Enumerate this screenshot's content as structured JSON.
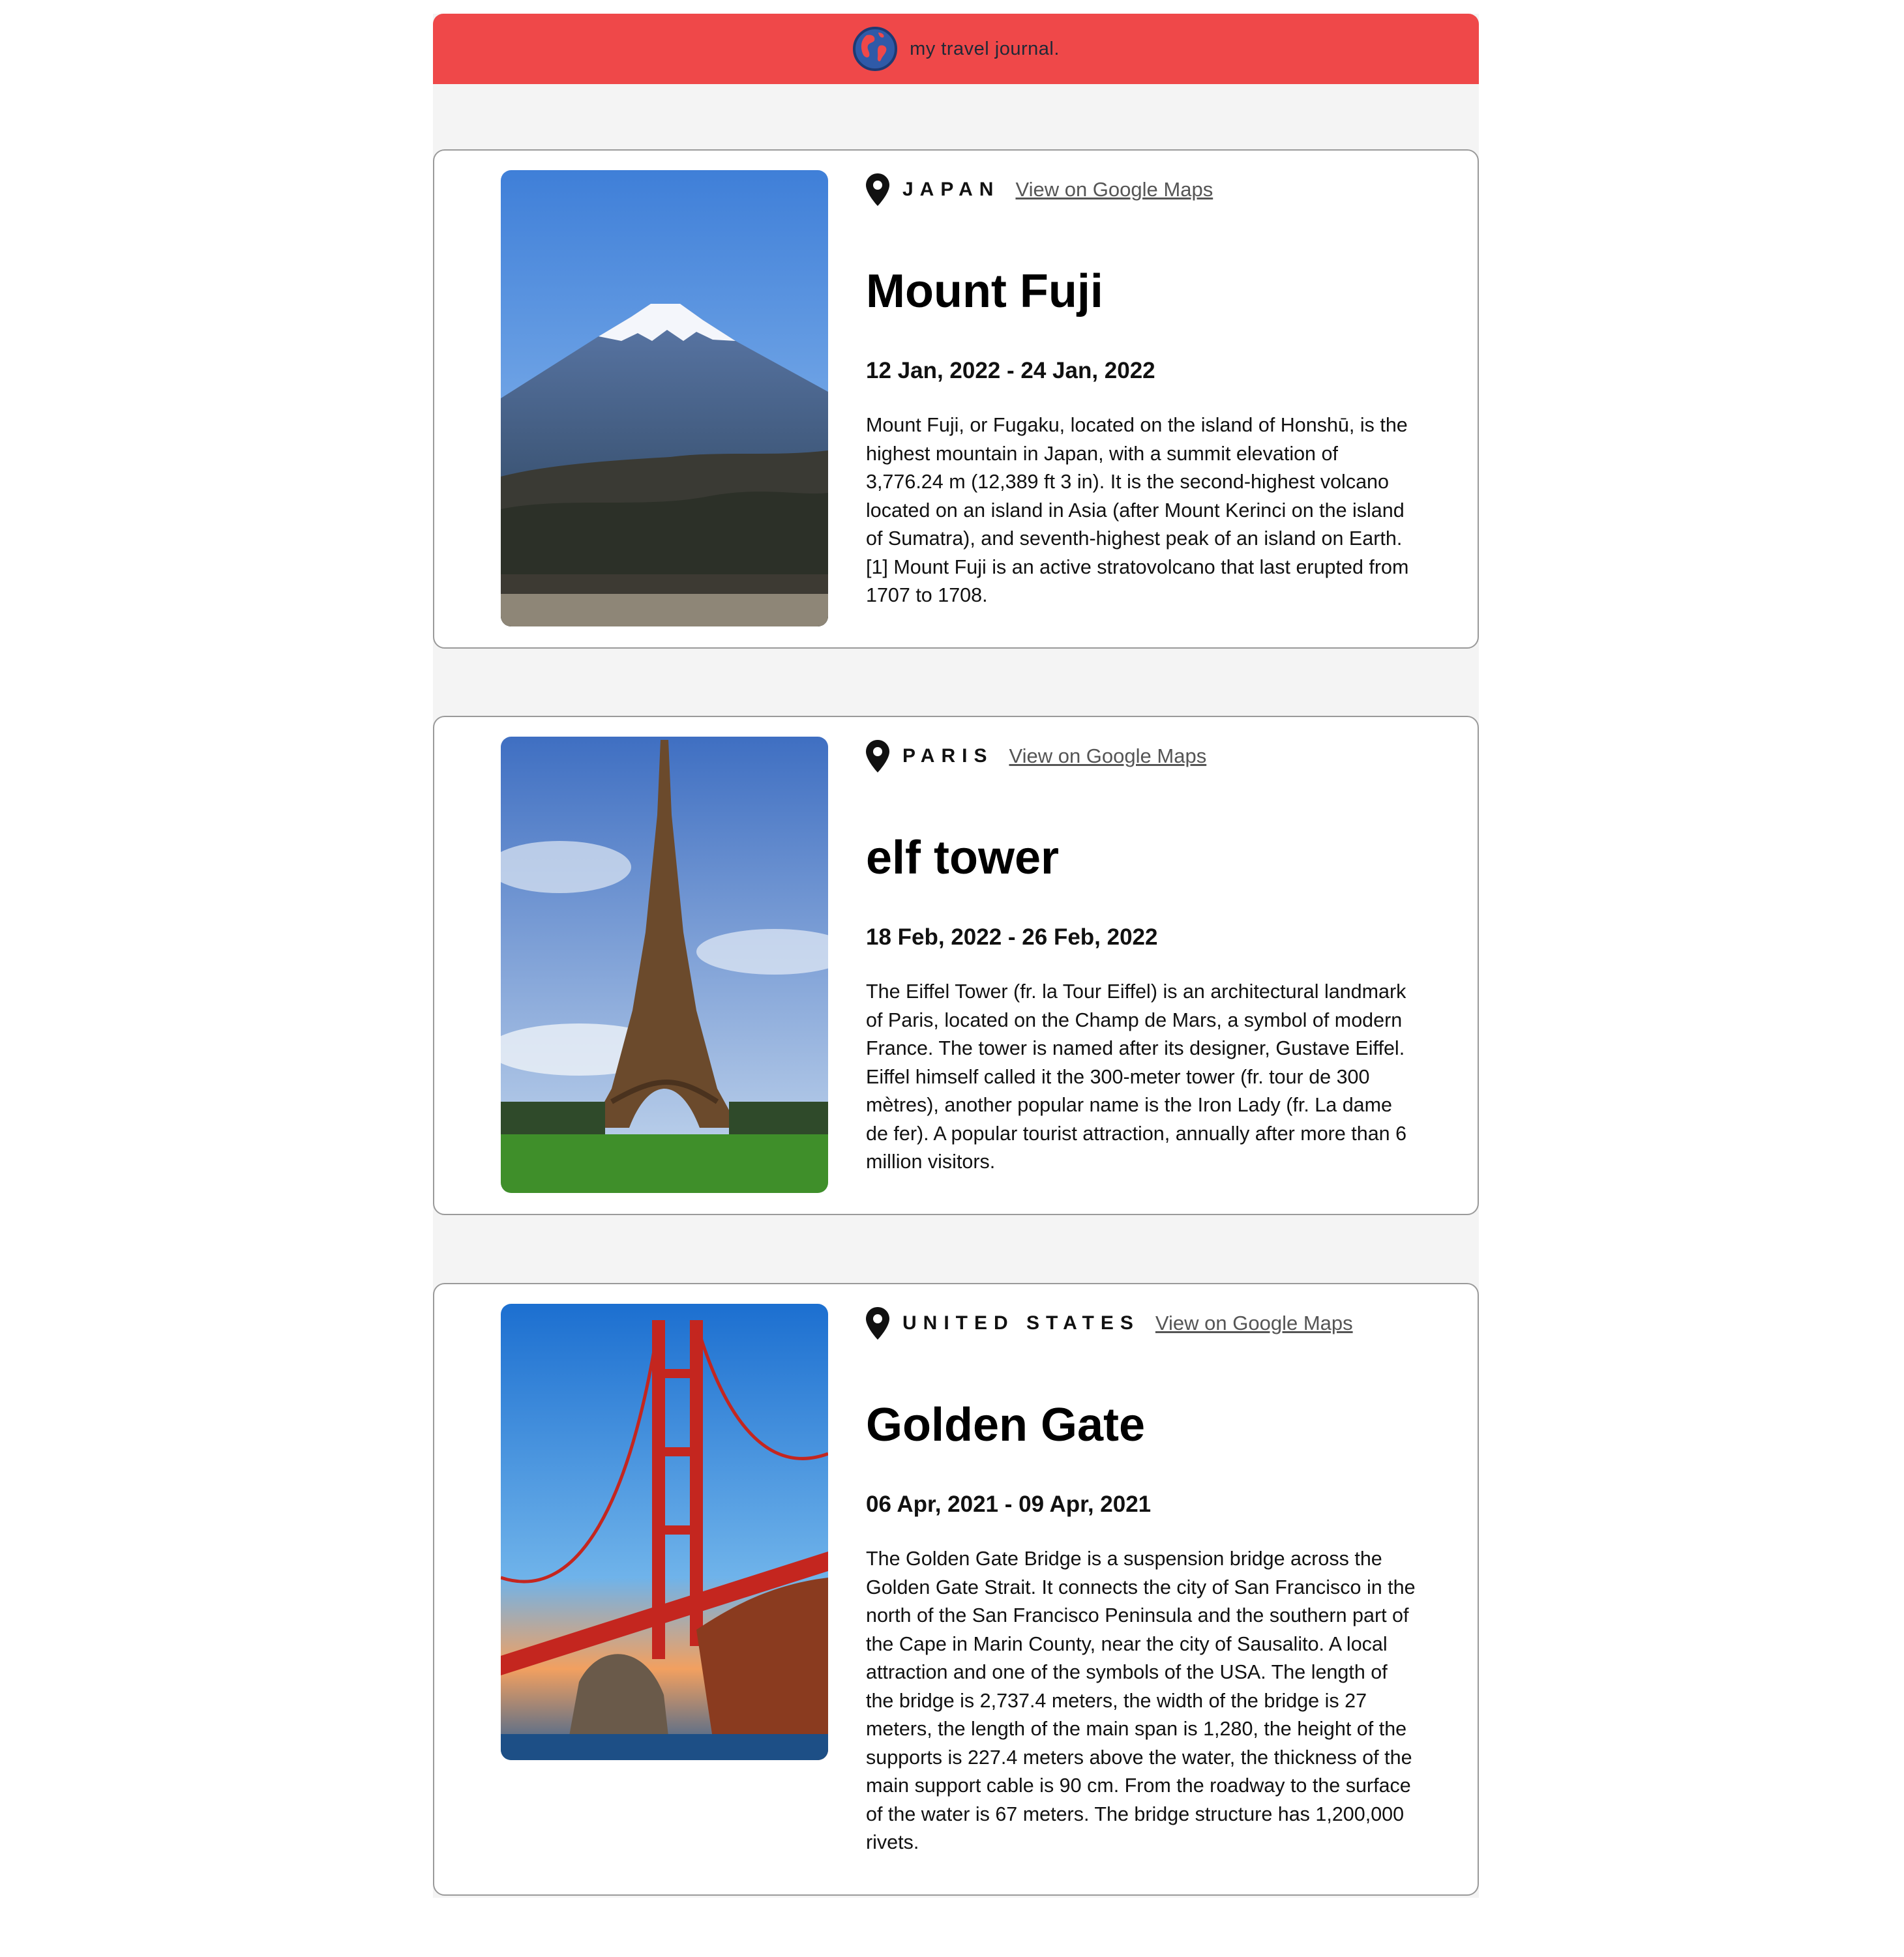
{
  "header": {
    "brand": "my travel journal.",
    "icon": "globe-icon",
    "color": "#ef4849"
  },
  "entries": [
    {
      "country": "JAPAN",
      "maps_label": "View on Google Maps",
      "title": "Mount Fuji",
      "dates": "12 Jan, 2022 - 24 Jan, 2022",
      "description": "Mount Fuji, or Fugaku, located on the island of Honshū, is the highest mountain in Japan, with a summit elevation of 3,776.24 m (12,389 ft 3 in). It is the second-highest volcano located on an island in Asia (after Mount Kerinci on the island of Sumatra), and seventh-highest peak of an island on Earth.[1] Mount Fuji is an active stratovolcano that last erupted from 1707 to 1708.",
      "image": "mount-fuji-photo"
    },
    {
      "country": "PARIS",
      "maps_label": "View on Google Maps",
      "title": "elf tower",
      "dates": "18 Feb, 2022 - 26 Feb, 2022",
      "description": "The Eiffel Tower (fr. la Tour Eiffel) is an architectural landmark of Paris, located on the Champ de Mars, a symbol of modern France. The tower is named after its designer, Gustave Eiffel. Eiffel himself called it the 300-meter tower (fr. tour de 300 mètres), another popular name is the Iron Lady (fr. La dame de fer). A popular tourist attraction, annually after more than 6 million visitors.",
      "image": "eiffel-tower-photo"
    },
    {
      "country": "UNITED STATES",
      "maps_label": "View on Google Maps",
      "title": "Golden Gate",
      "dates": "06 Apr, 2021 - 09 Apr, 2021",
      "description": "The Golden Gate Bridge is a suspension bridge across the Golden Gate Strait. It connects the city of San Francisco in the north of the San Francisco Peninsula and the southern part of the Cape in Marin County, near the city of Sausalito. A local attraction and one of the symbols of the USA. The length of the bridge is 2,737.4 meters, the width of the bridge is 27 meters, the length of the main span is 1,280, the height of the supports is 227.4 meters above the water, the thickness of the main support cable is 90 cm. From the roadway to the surface of the water is 67 meters. The bridge structure has 1,200,000 rivets.",
      "image": "golden-gate-photo"
    }
  ]
}
